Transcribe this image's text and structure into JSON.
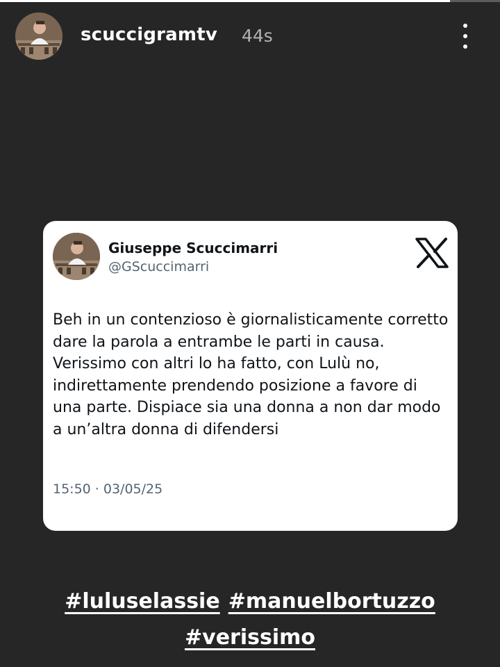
{
  "story": {
    "progress": 0.9,
    "username": "scuccigramtv",
    "time_ago": "44s",
    "more_icon": "more-vertical-icon"
  },
  "tweet": {
    "author_name": "Giuseppe Scuccimarri",
    "author_handle": "@GScuccimarri",
    "platform_icon": "x-logo-icon",
    "text": "Beh in un contenzioso è giornalisticamente corretto dare la parola a entrambe le parti in causa. Verissimo con altri lo ha fatto, con Lulù no, indirettamente prendendo posizione a favore di una parte. Dispiace sia una donna a non dar modo a un’altra donna di difendersi",
    "timestamp": "15:50 · 03/05/25"
  },
  "hashtags": [
    "#luluselassie",
    "#manuelbortuzzo",
    "#verissimo"
  ],
  "colors": {
    "background": "#262626",
    "card": "#ffffff",
    "text_primary": "#0f1419",
    "text_secondary": "#536471"
  }
}
